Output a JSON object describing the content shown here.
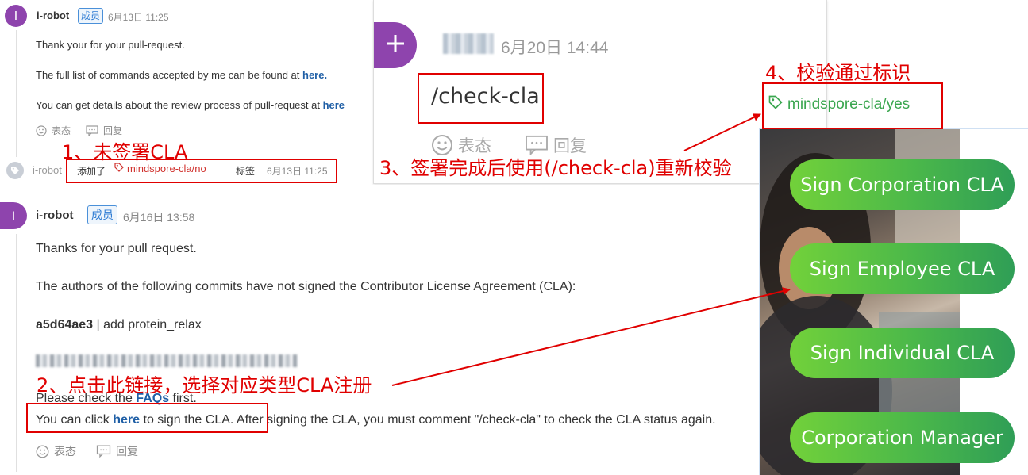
{
  "panel1": {
    "avatar_letter": "I",
    "username": "i-robot",
    "badge": "成员",
    "time": "6月13日 11:25",
    "lines": [
      {
        "text": "Thank your for your pull-request.",
        "link": ""
      },
      {
        "text": "The full list of commands accepted by me can be found at ",
        "link": "here."
      },
      {
        "text": "You can get details about the review process of pull-request at ",
        "link": "here"
      }
    ],
    "react_label": "表态",
    "reply_label": "回复",
    "event": {
      "actor": "i-robot",
      "added": "添加了",
      "label": "mindspore-cla/no",
      "label_word": "标签",
      "time": "6月13日 11:25"
    }
  },
  "panel2": {
    "username_blur": "",
    "time": "6月20日 14:44",
    "comment": "/check-cla",
    "react_label": "表态",
    "reply_label": "回复",
    "label_yes": "mindspore-cla/yes"
  },
  "panel3": {
    "avatar_letter": "I",
    "username": "i-robot",
    "badge": "成员",
    "time": "6月16日 13:58",
    "line1": "Thanks for your pull request.",
    "line2": "The authors of the following commits have not signed the Contributor License Agreement (CLA):",
    "commit_hash": "a5d64ae3",
    "commit_msg": " | add protein_relax",
    "faq_prefix": "Please check the ",
    "faq_link": "FAQs",
    "faq_suffix": " first.",
    "click_prefix": "You can click ",
    "click_link": "here",
    "click_suffix": " to sign the CLA. After signing the CLA, you must comment \"/check-cla\" to check the CLA status again.",
    "react_label": "表态",
    "reply_label": "回复"
  },
  "cla_buttons": [
    "Sign Corporation CLA",
    "Sign Employee CLA",
    "Sign Individual CLA",
    "Corporation Manager"
  ],
  "annotations": {
    "step1": "1、未签署CLA",
    "step2": "2、点击此链接，选择对应类型CLA注册",
    "step3": "3、签署完成后使用(/check-cla)重新校验",
    "step4": "4、校验通过标识"
  },
  "colors": {
    "annotation_red": "#e00000",
    "link_blue": "#1f5fa6",
    "label_red": "#d0312d",
    "label_green": "#3aa64f",
    "avatar_purple": "#8e44ad",
    "button_green": "#4bb84a"
  },
  "icons": [
    "smile-icon",
    "reply-icon",
    "tag-icon",
    "plus-icon"
  ]
}
